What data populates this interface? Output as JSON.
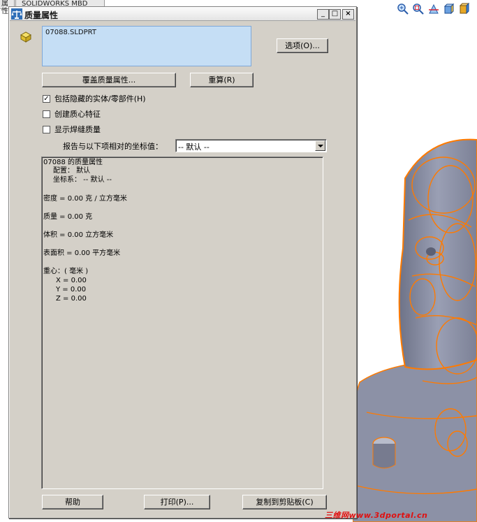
{
  "background": {
    "tabs": [
      "属性",
      "SOLIDWORKS MBD"
    ],
    "view_toolbar": [
      "zoom-to-fit-icon",
      "zoom-to-area-icon",
      "section-view-icon",
      "view-orientation-icon",
      "display-style-icon"
    ],
    "model_color": "#8a8fa6",
    "edge_color": "#ff7a00"
  },
  "dialog": {
    "title": "质量属性",
    "window_buttons": {
      "minimize": "_",
      "maximize": "□",
      "close": "×"
    },
    "selected_file": "07088.SLDPRT",
    "options_button": "选项(O)...",
    "override_button": "覆盖质量属性...",
    "recalculate_button": "重算(R)",
    "checkboxes": [
      {
        "label": "包括隐藏的实体/零部件(H)",
        "checked": true
      },
      {
        "label": "创建质心特征",
        "checked": false
      },
      {
        "label": "显示焊缝质量",
        "checked": false
      }
    ],
    "coordinate_label": "报告与以下项相对的坐标值：",
    "coordinate_value": "-- 默认 --",
    "results": {
      "heading": "07088 的质量属性",
      "configuration": "配置： 默认",
      "coordinate_system": "坐标系： -- 默认 --",
      "density": "密度 = 0.00 克 / 立方毫米",
      "mass": "质量 = 0.00 克",
      "volume": "体积 = 0.00 立方毫米",
      "surface_area": "表面积 = 0.00  平方毫米",
      "center_of_mass": "重心：( 毫米 )",
      "x": "X = 0.00",
      "y": "Y = 0.00",
      "z": "Z = 0.00"
    },
    "help_button": "帮助",
    "print_button": "打印(P)...",
    "copy_button": "复制到剪贴板(C)"
  },
  "watermark": "三维网www.3dportal.cn"
}
